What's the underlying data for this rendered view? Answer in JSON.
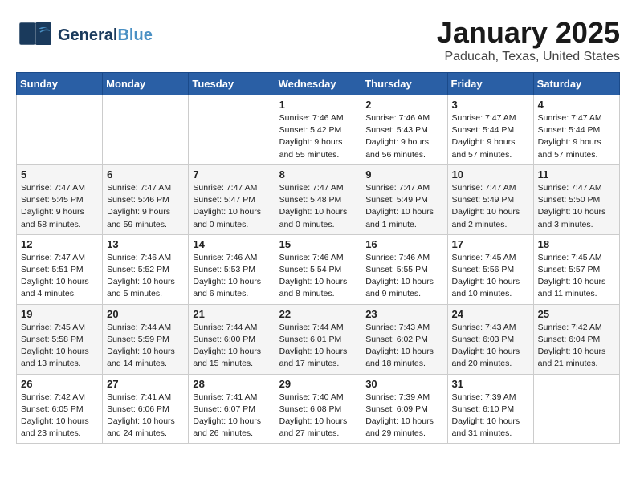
{
  "header": {
    "logo_general": "General",
    "logo_blue": "Blue",
    "month": "January 2025",
    "location": "Paducah, Texas, United States"
  },
  "weekdays": [
    "Sunday",
    "Monday",
    "Tuesday",
    "Wednesday",
    "Thursday",
    "Friday",
    "Saturday"
  ],
  "weeks": [
    [
      {
        "day": "",
        "content": ""
      },
      {
        "day": "",
        "content": ""
      },
      {
        "day": "",
        "content": ""
      },
      {
        "day": "1",
        "content": "Sunrise: 7:46 AM\nSunset: 5:42 PM\nDaylight: 9 hours\nand 55 minutes."
      },
      {
        "day": "2",
        "content": "Sunrise: 7:46 AM\nSunset: 5:43 PM\nDaylight: 9 hours\nand 56 minutes."
      },
      {
        "day": "3",
        "content": "Sunrise: 7:47 AM\nSunset: 5:44 PM\nDaylight: 9 hours\nand 57 minutes."
      },
      {
        "day": "4",
        "content": "Sunrise: 7:47 AM\nSunset: 5:44 PM\nDaylight: 9 hours\nand 57 minutes."
      }
    ],
    [
      {
        "day": "5",
        "content": "Sunrise: 7:47 AM\nSunset: 5:45 PM\nDaylight: 9 hours\nand 58 minutes."
      },
      {
        "day": "6",
        "content": "Sunrise: 7:47 AM\nSunset: 5:46 PM\nDaylight: 9 hours\nand 59 minutes."
      },
      {
        "day": "7",
        "content": "Sunrise: 7:47 AM\nSunset: 5:47 PM\nDaylight: 10 hours\nand 0 minutes."
      },
      {
        "day": "8",
        "content": "Sunrise: 7:47 AM\nSunset: 5:48 PM\nDaylight: 10 hours\nand 0 minutes."
      },
      {
        "day": "9",
        "content": "Sunrise: 7:47 AM\nSunset: 5:49 PM\nDaylight: 10 hours\nand 1 minute."
      },
      {
        "day": "10",
        "content": "Sunrise: 7:47 AM\nSunset: 5:49 PM\nDaylight: 10 hours\nand 2 minutes."
      },
      {
        "day": "11",
        "content": "Sunrise: 7:47 AM\nSunset: 5:50 PM\nDaylight: 10 hours\nand 3 minutes."
      }
    ],
    [
      {
        "day": "12",
        "content": "Sunrise: 7:47 AM\nSunset: 5:51 PM\nDaylight: 10 hours\nand 4 minutes."
      },
      {
        "day": "13",
        "content": "Sunrise: 7:46 AM\nSunset: 5:52 PM\nDaylight: 10 hours\nand 5 minutes."
      },
      {
        "day": "14",
        "content": "Sunrise: 7:46 AM\nSunset: 5:53 PM\nDaylight: 10 hours\nand 6 minutes."
      },
      {
        "day": "15",
        "content": "Sunrise: 7:46 AM\nSunset: 5:54 PM\nDaylight: 10 hours\nand 8 minutes."
      },
      {
        "day": "16",
        "content": "Sunrise: 7:46 AM\nSunset: 5:55 PM\nDaylight: 10 hours\nand 9 minutes."
      },
      {
        "day": "17",
        "content": "Sunrise: 7:45 AM\nSunset: 5:56 PM\nDaylight: 10 hours\nand 10 minutes."
      },
      {
        "day": "18",
        "content": "Sunrise: 7:45 AM\nSunset: 5:57 PM\nDaylight: 10 hours\nand 11 minutes."
      }
    ],
    [
      {
        "day": "19",
        "content": "Sunrise: 7:45 AM\nSunset: 5:58 PM\nDaylight: 10 hours\nand 13 minutes."
      },
      {
        "day": "20",
        "content": "Sunrise: 7:44 AM\nSunset: 5:59 PM\nDaylight: 10 hours\nand 14 minutes."
      },
      {
        "day": "21",
        "content": "Sunrise: 7:44 AM\nSunset: 6:00 PM\nDaylight: 10 hours\nand 15 minutes."
      },
      {
        "day": "22",
        "content": "Sunrise: 7:44 AM\nSunset: 6:01 PM\nDaylight: 10 hours\nand 17 minutes."
      },
      {
        "day": "23",
        "content": "Sunrise: 7:43 AM\nSunset: 6:02 PM\nDaylight: 10 hours\nand 18 minutes."
      },
      {
        "day": "24",
        "content": "Sunrise: 7:43 AM\nSunset: 6:03 PM\nDaylight: 10 hours\nand 20 minutes."
      },
      {
        "day": "25",
        "content": "Sunrise: 7:42 AM\nSunset: 6:04 PM\nDaylight: 10 hours\nand 21 minutes."
      }
    ],
    [
      {
        "day": "26",
        "content": "Sunrise: 7:42 AM\nSunset: 6:05 PM\nDaylight: 10 hours\nand 23 minutes."
      },
      {
        "day": "27",
        "content": "Sunrise: 7:41 AM\nSunset: 6:06 PM\nDaylight: 10 hours\nand 24 minutes."
      },
      {
        "day": "28",
        "content": "Sunrise: 7:41 AM\nSunset: 6:07 PM\nDaylight: 10 hours\nand 26 minutes."
      },
      {
        "day": "29",
        "content": "Sunrise: 7:40 AM\nSunset: 6:08 PM\nDaylight: 10 hours\nand 27 minutes."
      },
      {
        "day": "30",
        "content": "Sunrise: 7:39 AM\nSunset: 6:09 PM\nDaylight: 10 hours\nand 29 minutes."
      },
      {
        "day": "31",
        "content": "Sunrise: 7:39 AM\nSunset: 6:10 PM\nDaylight: 10 hours\nand 31 minutes."
      },
      {
        "day": "",
        "content": ""
      }
    ]
  ]
}
